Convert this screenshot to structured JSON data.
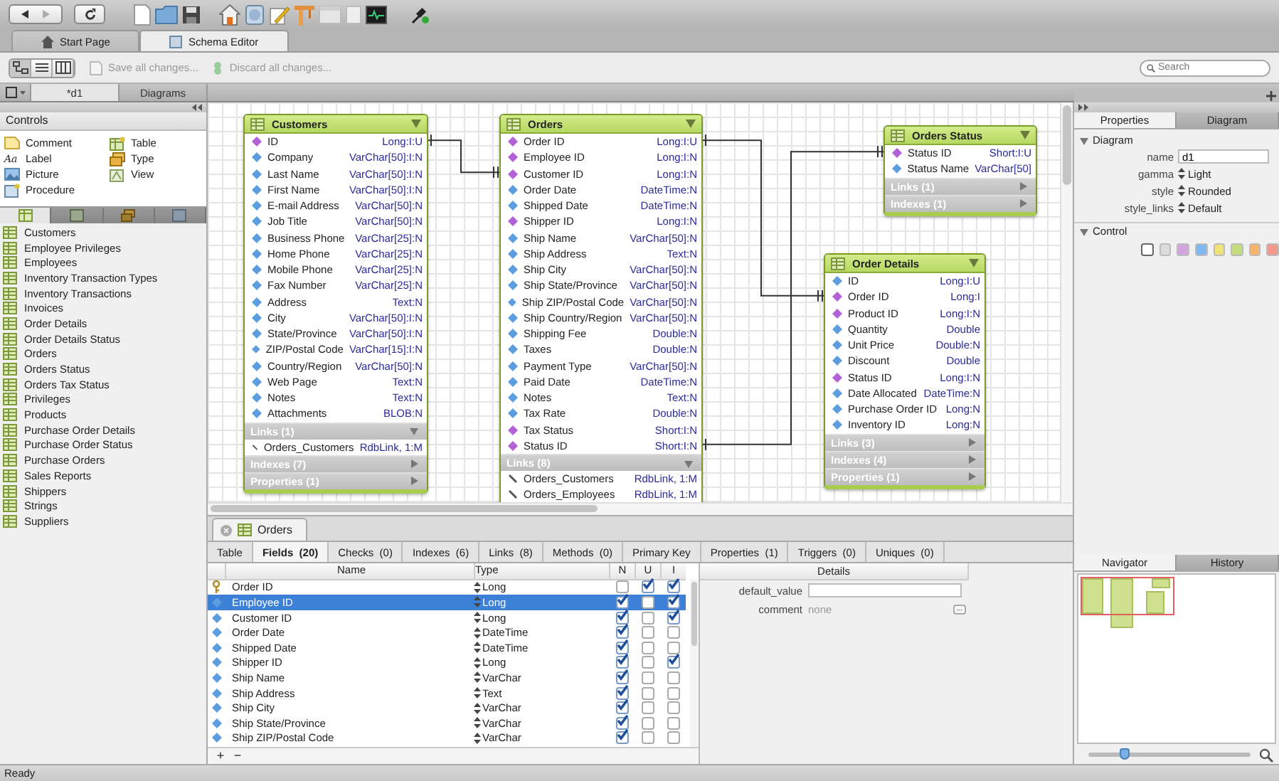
{
  "doc_tabs": [
    {
      "label": "Start Page",
      "kind": "home",
      "selected": false
    },
    {
      "label": "Schema Editor",
      "kind": "schema",
      "selected": true
    }
  ],
  "view_modes": [
    {
      "kind": "diagram",
      "selected": true
    },
    {
      "kind": "list",
      "selected": false
    },
    {
      "kind": "columns",
      "selected": false
    }
  ],
  "actions": [
    {
      "label": "Save all changes...",
      "kind": "save",
      "disabled": true
    },
    {
      "label": "Discard all changes...",
      "kind": "discard",
      "disabled": true
    }
  ],
  "search": {
    "placeholder": "Search"
  },
  "editor_tabs": [
    {
      "label": "*d1",
      "selected": true
    },
    {
      "label": "Diagrams",
      "selected": false
    }
  ],
  "sidebar": {
    "title": "Controls",
    "controls": [
      {
        "label": "Comment",
        "kind": "comment"
      },
      {
        "label": "Label",
        "kind": "label",
        "glyph": "Aa"
      },
      {
        "label": "Picture",
        "kind": "picture"
      },
      {
        "label": "Procedure",
        "kind": "procedure"
      },
      {
        "label": "Table",
        "kind": "table"
      },
      {
        "label": "Type",
        "kind": "type"
      },
      {
        "label": "View",
        "kind": "view"
      }
    ],
    "object_tabs": [
      {
        "kind": "tables",
        "selected": true
      },
      {
        "kind": "views",
        "selected": false
      },
      {
        "kind": "types",
        "selected": false
      },
      {
        "kind": "procedures",
        "selected": false
      }
    ],
    "tables": [
      "Customers",
      "Employee Privileges",
      "Employees",
      "Inventory Transaction Types",
      "Inventory Transactions",
      "Invoices",
      "Order Details",
      "Order Details Status",
      "Orders",
      "Orders Status",
      "Orders Tax Status",
      "Privileges",
      "Products",
      "Purchase Order Details",
      "Purchase Order Status",
      "Purchase Orders",
      "Sales Reports",
      "Shippers",
      "Strings",
      "Suppliers"
    ]
  },
  "diagram": {
    "tables": [
      {
        "title": "Customers",
        "fields": [
          {
            "name": "ID",
            "type": "Long:I:U",
            "kind": "key"
          },
          {
            "name": "Company",
            "type": "VarChar[50]:I:N",
            "kind": "field"
          },
          {
            "name": "Last Name",
            "type": "VarChar[50]:I:N",
            "kind": "field"
          },
          {
            "name": "First Name",
            "type": "VarChar[50]:I:N",
            "kind": "field"
          },
          {
            "name": "E-mail Address",
            "type": "VarChar[50]:N",
            "kind": "field"
          },
          {
            "name": "Job Title",
            "type": "VarChar[50]:N",
            "kind": "field"
          },
          {
            "name": "Business Phone",
            "type": "VarChar[25]:N",
            "kind": "field"
          },
          {
            "name": "Home Phone",
            "type": "VarChar[25]:N",
            "kind": "field"
          },
          {
            "name": "Mobile Phone",
            "type": "VarChar[25]:N",
            "kind": "field"
          },
          {
            "name": "Fax Number",
            "type": "VarChar[25]:N",
            "kind": "field"
          },
          {
            "name": "Address",
            "type": "Text:N",
            "kind": "field"
          },
          {
            "name": "City",
            "type": "VarChar[50]:I:N",
            "kind": "field"
          },
          {
            "name": "State/Province",
            "type": "VarChar[50]:I:N",
            "kind": "field"
          },
          {
            "name": "ZIP/Postal Code",
            "type": "VarChar[15]:I:N",
            "kind": "field"
          },
          {
            "name": "Country/Region",
            "type": "VarChar[50]:N",
            "kind": "field"
          },
          {
            "name": "Web Page",
            "type": "Text:N",
            "kind": "field"
          },
          {
            "name": "Notes",
            "type": "Text:N",
            "kind": "field"
          },
          {
            "name": "Attachments",
            "type": "BLOB:N",
            "kind": "field"
          }
        ],
        "sections": [
          {
            "label": "Links (1)",
            "expanded": true,
            "items": [
              {
                "name": "Orders_Customers",
                "type": "RdbLink, 1:M"
              }
            ]
          },
          {
            "label": "Indexes (7)",
            "expanded": false
          },
          {
            "label": "Properties (1)",
            "expanded": false
          }
        ]
      },
      {
        "title": "Orders",
        "fields": [
          {
            "name": "Order ID",
            "type": "Long:I:U",
            "kind": "key"
          },
          {
            "name": "Employee ID",
            "type": "Long:I:N",
            "kind": "key"
          },
          {
            "name": "Customer ID",
            "type": "Long:I:N",
            "kind": "key"
          },
          {
            "name": "Order Date",
            "type": "DateTime:N",
            "kind": "field"
          },
          {
            "name": "Shipped Date",
            "type": "DateTime:N",
            "kind": "field"
          },
          {
            "name": "Shipper ID",
            "type": "Long:I:N",
            "kind": "key"
          },
          {
            "name": "Ship Name",
            "type": "VarChar[50]:N",
            "kind": "field"
          },
          {
            "name": "Ship Address",
            "type": "Text:N",
            "kind": "field"
          },
          {
            "name": "Ship City",
            "type": "VarChar[50]:N",
            "kind": "field"
          },
          {
            "name": "Ship State/Province",
            "type": "VarChar[50]:N",
            "kind": "field"
          },
          {
            "name": "Ship ZIP/Postal Code",
            "type": "VarChar[50]:N",
            "kind": "field"
          },
          {
            "name": "Ship Country/Region",
            "type": "VarChar[50]:N",
            "kind": "field"
          },
          {
            "name": "Shipping Fee",
            "type": "Double:N",
            "kind": "field"
          },
          {
            "name": "Taxes",
            "type": "Double:N",
            "kind": "field"
          },
          {
            "name": "Payment Type",
            "type": "VarChar[50]:N",
            "kind": "field"
          },
          {
            "name": "Paid Date",
            "type": "DateTime:N",
            "kind": "field"
          },
          {
            "name": "Notes",
            "type": "Text:N",
            "kind": "field"
          },
          {
            "name": "Tax Rate",
            "type": "Double:N",
            "kind": "field"
          },
          {
            "name": "Tax Status",
            "type": "Short:I:N",
            "kind": "key"
          },
          {
            "name": "Status ID",
            "type": "Short:I:N",
            "kind": "key"
          }
        ],
        "sections": [
          {
            "label": "Links (8)",
            "expanded": true,
            "items": [
              {
                "name": "Orders_Customers",
                "type": "RdbLink, 1:M"
              },
              {
                "name": "Orders_Employees",
                "type": "RdbLink, 1:M"
              }
            ]
          }
        ]
      },
      {
        "title": "Orders Status",
        "fields": [
          {
            "name": "Status ID",
            "type": "Short:I:U",
            "kind": "key"
          },
          {
            "name": "Status Name",
            "type": "VarChar[50]",
            "kind": "field"
          }
        ],
        "sections": [
          {
            "label": "Links (1)",
            "expanded": false
          },
          {
            "label": "Indexes (1)",
            "expanded": false
          }
        ]
      },
      {
        "title": "Order Details",
        "fields": [
          {
            "name": "ID",
            "type": "Long:I:U",
            "kind": "field"
          },
          {
            "name": "Order ID",
            "type": "Long:I",
            "kind": "key"
          },
          {
            "name": "Product ID",
            "type": "Long:I:N",
            "kind": "key"
          },
          {
            "name": "Quantity",
            "type": "Double",
            "kind": "field"
          },
          {
            "name": "Unit Price",
            "type": "Double:N",
            "kind": "field"
          },
          {
            "name": "Discount",
            "type": "Double",
            "kind": "field"
          },
          {
            "name": "Status ID",
            "type": "Long:I:N",
            "kind": "key"
          },
          {
            "name": "Date Allocated",
            "type": "DateTime:N",
            "kind": "field"
          },
          {
            "name": "Purchase Order ID",
            "type": "Long:N",
            "kind": "field"
          },
          {
            "name": "Inventory ID",
            "type": "Long:N",
            "kind": "field"
          }
        ],
        "sections": [
          {
            "label": "Links (3)",
            "expanded": false
          },
          {
            "label": "Indexes (4)",
            "expanded": false
          },
          {
            "label": "Properties (1)",
            "expanded": false
          }
        ]
      }
    ]
  },
  "editor": {
    "title": "Orders",
    "tabs": [
      {
        "label": "Table",
        "selected": false
      },
      {
        "label": "Fields  (20)",
        "selected": true
      },
      {
        "label": "Checks  (0)",
        "selected": false
      },
      {
        "label": "Indexes  (6)",
        "selected": false
      },
      {
        "label": "Links  (8)",
        "selected": false
      },
      {
        "label": "Methods  (0)",
        "selected": false
      },
      {
        "label": "Primary Key",
        "selected": false
      },
      {
        "label": "Properties  (1)",
        "selected": false
      },
      {
        "label": "Triggers  (0)",
        "selected": false
      },
      {
        "label": "Uniques  (0)",
        "selected": false
      }
    ],
    "columns": [
      "Name",
      "Type",
      "N",
      "U",
      "I"
    ],
    "fields": [
      {
        "name": "Order ID",
        "type": "Long",
        "kind": "primary",
        "n": false,
        "u": true,
        "i": true,
        "selected": false
      },
      {
        "name": "Employee ID",
        "type": "Long",
        "kind": "field",
        "n": true,
        "u": false,
        "i": true,
        "selected": true
      },
      {
        "name": "Customer ID",
        "type": "Long",
        "kind": "field",
        "n": true,
        "u": false,
        "i": true,
        "selected": false
      },
      {
        "name": "Order Date",
        "type": "DateTime",
        "kind": "field",
        "n": true,
        "u": false,
        "i": false,
        "selected": false
      },
      {
        "name": "Shipped Date",
        "type": "DateTime",
        "kind": "field",
        "n": true,
        "u": false,
        "i": false,
        "selected": false
      },
      {
        "name": "Shipper ID",
        "type": "Long",
        "kind": "field",
        "n": true,
        "u": false,
        "i": true,
        "selected": false
      },
      {
        "name": "Ship Name",
        "type": "VarChar",
        "kind": "field",
        "n": true,
        "u": false,
        "i": false,
        "selected": false
      },
      {
        "name": "Ship Address",
        "type": "Text",
        "kind": "field",
        "n": true,
        "u": false,
        "i": false,
        "selected": false
      },
      {
        "name": "Ship City",
        "type": "VarChar",
        "kind": "field",
        "n": true,
        "u": false,
        "i": false,
        "selected": false
      },
      {
        "name": "Ship State/Province",
        "type": "VarChar",
        "kind": "field",
        "n": true,
        "u": false,
        "i": false,
        "selected": false
      },
      {
        "name": "Ship ZIP/Postal Code",
        "type": "VarChar",
        "kind": "field",
        "n": true,
        "u": false,
        "i": false,
        "selected": false
      }
    ],
    "add": "+",
    "remove": "−",
    "details": {
      "title": "Details",
      "default_label": "default_value",
      "comment_label": "comment",
      "comment_value": "none",
      "more": "..."
    }
  },
  "properties": {
    "tabs": [
      {
        "label": "Properties",
        "selected": true
      },
      {
        "label": "Diagram",
        "selected": false
      }
    ],
    "diagram_section": {
      "title": "Diagram",
      "expanded": true,
      "props": [
        {
          "label": "name",
          "kind": "text",
          "value": "d1"
        },
        {
          "label": "gamma",
          "kind": "popup",
          "value": "Light"
        },
        {
          "label": "style",
          "kind": "popup",
          "value": "Rounded"
        },
        {
          "label": "style_links",
          "kind": "popup",
          "value": "Default"
        }
      ]
    },
    "control_section": {
      "title": "Control",
      "expanded": true
    },
    "swatches": [
      {
        "color": "#ffffff",
        "selected": true
      },
      {
        "color": "#dcdcdc",
        "selected": false
      },
      {
        "color": "#d4a6e0",
        "selected": false
      },
      {
        "color": "#7fb8f0",
        "selected": false
      },
      {
        "color": "#f2e27a",
        "selected": false
      },
      {
        "color": "#c4dc7c",
        "selected": false
      },
      {
        "color": "#f5b46a",
        "selected": false
      },
      {
        "color": "#f29a8e",
        "selected": false
      }
    ]
  },
  "navigator": {
    "tabs": [
      {
        "label": "Navigator",
        "selected": true
      },
      {
        "label": "History",
        "selected": false
      }
    ],
    "zoom": {
      "level": 0.22
    }
  },
  "status_bar": "Ready"
}
